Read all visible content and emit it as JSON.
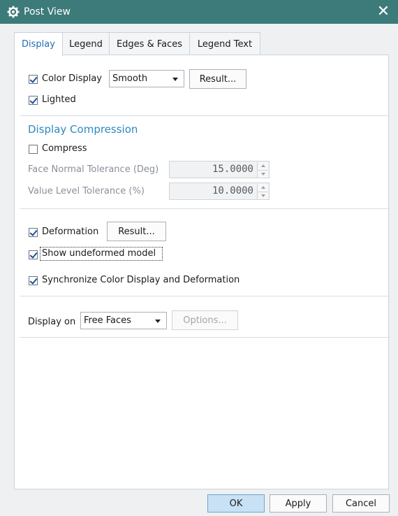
{
  "window": {
    "title": "Post View",
    "title_icon": "gear-icon",
    "close_icon": "close-icon"
  },
  "tabs": [
    {
      "label": "Display",
      "active": true
    },
    {
      "label": "Legend",
      "active": false
    },
    {
      "label": "Edges & Faces",
      "active": false
    },
    {
      "label": "Legend Text",
      "active": false
    }
  ],
  "display": {
    "color_display": {
      "label": "Color Display",
      "checked": true,
      "mode": "Smooth",
      "result_button": "Result..."
    },
    "lighted": {
      "label": "Lighted",
      "checked": true
    }
  },
  "compression": {
    "heading": "Display Compression",
    "compress": {
      "label": "Compress",
      "checked": false
    },
    "face_normal": {
      "label": "Face Normal Tolerance (Deg)",
      "value": "15.0000"
    },
    "value_level": {
      "label": "Value Level Tolerance (%)",
      "value": "10.0000"
    }
  },
  "deformation": {
    "deformation": {
      "label": "Deformation",
      "checked": true,
      "result_button": "Result..."
    },
    "show_undeformed": {
      "label": "Show undeformed model",
      "checked": true
    },
    "synchronize": {
      "label": "Synchronize Color Display and Deformation",
      "checked": true
    }
  },
  "display_on": {
    "label": "Display on",
    "value": "Free Faces",
    "options_button": "Options..."
  },
  "footer": {
    "ok": "OK",
    "apply": "Apply",
    "cancel": "Cancel"
  },
  "colors": {
    "titlebar": "#3d7a7a",
    "accent": "#2e8ac0",
    "primary_button": "#c9e1f4"
  }
}
